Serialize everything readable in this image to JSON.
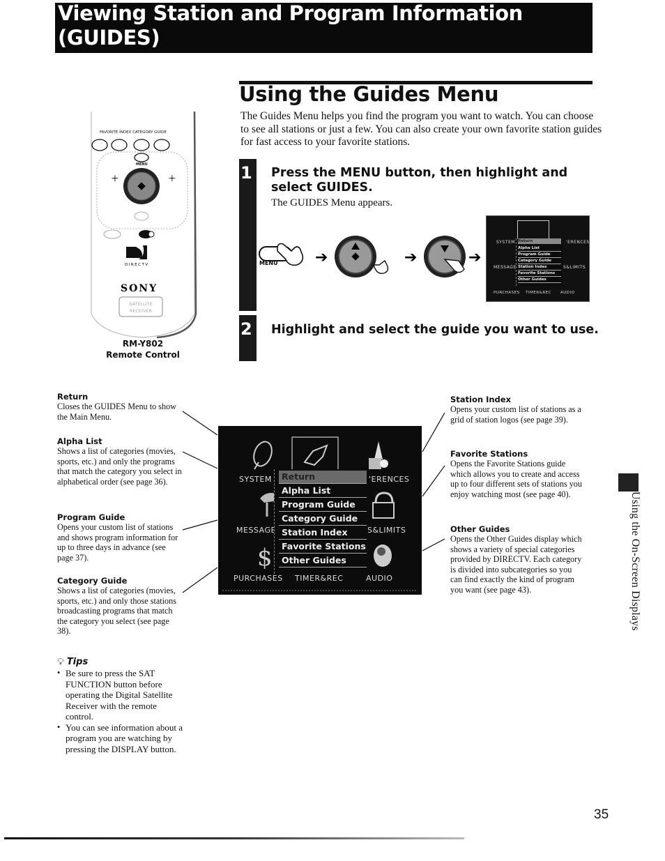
{
  "header": {
    "title_line1": "Viewing Station and Program Information",
    "title_line2": "(GUIDES)"
  },
  "section": {
    "title": "Using the Guides Menu",
    "intro": "The Guides Menu helps you find the program you want to watch. You can choose to see all stations or just a few. You can also create your own favorite station guides for fast access to your favorite stations."
  },
  "steps": [
    {
      "number": "1",
      "heading": "Press the MENU button, then highlight and select GUIDES.",
      "subtext": "The GUIDES Menu appears."
    },
    {
      "number": "2",
      "heading": "Highlight and select the guide you want to use."
    }
  ],
  "remote": {
    "button_labels": [
      "FAVORITE",
      "INDEX",
      "CATEGORY",
      "GUIDE"
    ],
    "menu_label": "MENU",
    "brand_logo": "DIRECTV",
    "brand": "SONY",
    "badge_line1": "SATELLITE",
    "badge_line2": "RECEIVER",
    "model": "RM-Y802",
    "caption": "Remote Control"
  },
  "diagram": {
    "menu_button_label": "MENU",
    "arrow": "➔"
  },
  "guides_menu": {
    "corner_labels": [
      "SYSTEM",
      "PREFERENCES",
      "MESSAGES",
      "LOCKS & LIMITS",
      "PURCHASES",
      "TIMER&REC",
      "AUDIO"
    ],
    "visible_labels": {
      "system": "SYSTEM",
      "preferences": "'ERENCES",
      "messages": "MESSAGES",
      "limits": "S&LIMITS",
      "purchases": "PURCHASES",
      "timer": "TIMER&REC",
      "audio": "AUDIO"
    },
    "items": [
      "Return",
      "Alpha List",
      "Program Guide",
      "Category Guide",
      "Station Index",
      "Favorite Stations",
      "Other Guides"
    ],
    "selected": "Return"
  },
  "annotations_left": [
    {
      "title": "Return",
      "body": "Closes the GUIDES Menu to show the Main Menu."
    },
    {
      "title": "Alpha List",
      "body": "Shows a list of categories (movies, sports, etc.) and only the programs that match the category you select in alphabetical order (see page 36)."
    },
    {
      "title": "Program Guide",
      "body": "Opens your custom list of stations and shows program information for up to three days in advance (see page 37)."
    },
    {
      "title": "Category Guide",
      "body": "Shows a list of categories (movies, sports, etc.) and only those stations broadcasting programs that match the category you select (see page 38)."
    }
  ],
  "annotations_right": [
    {
      "title": "Station Index",
      "body": "Opens your custom list of stations as a grid of station logos (see page 39)."
    },
    {
      "title": "Favorite Stations",
      "body": "Opens the Favorite Stations guide which allows you to create and access up to four different sets of stations you enjoy watching most (see page 40)."
    },
    {
      "title": "Other Guides",
      "body": "Opens the Other Guides display which shows a variety of special categories provided by DIRECTV. Each category is divided into subcategories so you can find exactly the kind of program you want (see page 43)."
    }
  ],
  "tips": {
    "title": "Tips",
    "items": [
      "Be sure to press the SAT FUNCTION button before operating the Digital Satellite Receiver with the remote control.",
      "You can see information about a program you are watching by pressing the DISPLAY button."
    ]
  },
  "side_tab": {
    "label": "Using the On-Screen Displays"
  },
  "footer": {
    "page_number": "35"
  }
}
